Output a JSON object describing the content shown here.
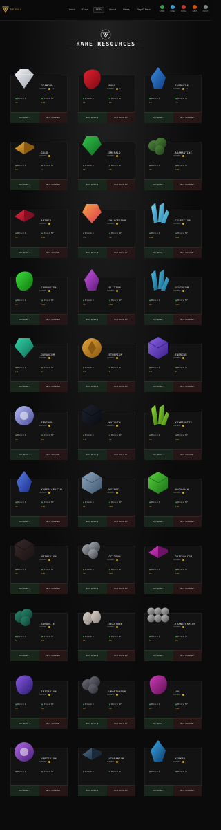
{
  "brand": {
    "name": "NEBULA"
  },
  "nav": [
    "Land",
    "Skins",
    "NFTs",
    "About",
    "News",
    "Play & Earn"
  ],
  "nav_active": 2,
  "tokens": [
    {
      "label": "STAR",
      "color": "#2ea043"
    },
    {
      "label": "LUNA",
      "color": "#3da0d8"
    },
    {
      "label": "NOVA",
      "color": "#c0392b"
    },
    {
      "label": "GEM",
      "color": "#d35400"
    },
    {
      "label": "DUST",
      "color": "#7f8c8d"
    }
  ],
  "page_title": "RARE RESOURCES",
  "labels": {
    "owned": "OWNED:",
    "price_usd": "Price in $",
    "price_nf": "Price in NF",
    "buy": "BUY WITH $",
    "sell": "BUY WITH NF"
  },
  "resources": [
    {
      "name": "DIAMOND",
      "owned": "12",
      "usd": "30",
      "nf": "125",
      "icon": "diamond"
    },
    {
      "name": "RUBY",
      "owned": "6",
      "usd": "15",
      "nf": "60",
      "icon": "ruby"
    },
    {
      "name": "SAPPHIRE",
      "owned": "11",
      "usd": "18",
      "nf": "75",
      "icon": "sapphire"
    },
    {
      "name": "GOLD",
      "owned": "",
      "usd": "10",
      "nf": "3",
      "icon": "gold"
    },
    {
      "name": "EMERALD",
      "owned": "",
      "usd": "12",
      "nf": "48",
      "icon": "emerald"
    },
    {
      "name": "ADAMANTINE",
      "owned": "",
      "usd": "40",
      "nf": "160",
      "icon": "adamantine"
    },
    {
      "name": "AETHER",
      "owned": "",
      "usd": "35",
      "nf": "140",
      "icon": "aether"
    },
    {
      "name": "CHALCEDIUM",
      "owned": "",
      "usd": "7.5",
      "nf": "30",
      "icon": "chalcedium"
    },
    {
      "name": "CELESTIUM",
      "owned": "",
      "usd": "100",
      "nf": "400",
      "icon": "celestium"
    },
    {
      "name": "CHRONOTON",
      "owned": "",
      "usd": "25",
      "nf": "100",
      "icon": "chronoton"
    },
    {
      "name": "ELITIUM",
      "owned": "",
      "usd": "50",
      "nf": "200",
      "icon": "elitium"
    },
    {
      "name": "DIVINIUM",
      "owned": "",
      "usd": "80",
      "nf": "320",
      "icon": "divinium"
    },
    {
      "name": "DURANIUM",
      "owned": "",
      "usd": "1.5",
      "nf": "6",
      "icon": "duranium"
    },
    {
      "name": "ETHERIUM",
      "owned": "",
      "usd": "1.5",
      "nf": "6",
      "icon": "etherium"
    },
    {
      "name": "ENERGON",
      "owned": "",
      "usd": "1.5",
      "nf": "6",
      "icon": "energon"
    },
    {
      "name": "FEMINOR",
      "owned": "",
      "usd": "20",
      "nf": "80",
      "icon": "feminor"
    },
    {
      "name": "KATCHIN",
      "owned": "",
      "usd": "5.5",
      "nf": "22",
      "icon": "katchin"
    },
    {
      "name": "KRYPTONITE",
      "owned": "",
      "usd": "50",
      "nf": "200",
      "icon": "kryptonite"
    },
    {
      "name": "KYBER CRYSTAL",
      "owned": "",
      "usd": "45",
      "nf": "180",
      "icon": "kyber"
    },
    {
      "name": "MYTHRIL",
      "owned": "",
      "usd": "65",
      "nf": "260",
      "icon": "mythril"
    },
    {
      "name": "NAQAHDAH",
      "owned": "",
      "usd": "45",
      "nf": "180",
      "icon": "naqahdah"
    },
    {
      "name": "NETHERIUM",
      "owned": "",
      "usd": "40",
      "nf": "160",
      "icon": "netherium"
    },
    {
      "name": "OCTIRON",
      "owned": "",
      "usd": "30",
      "nf": "120",
      "icon": "octiron"
    },
    {
      "name": "ORICHALCUM",
      "owned": "",
      "usd": "25",
      "nf": "100",
      "icon": "orichalcum"
    },
    {
      "name": "SARONITE",
      "owned": "",
      "usd": "5",
      "nf": "20",
      "icon": "saronite"
    },
    {
      "name": "SEASTONE",
      "owned": "",
      "usd": "15",
      "nf": "60",
      "icon": "seastone"
    },
    {
      "name": "TRANSFERMIUM",
      "owned": "",
      "usd": "5",
      "nf": "20",
      "icon": "transfermium"
    },
    {
      "name": "TRITANIUM",
      "owned": "",
      "usd": "20",
      "nf": "80",
      "icon": "tritanium"
    },
    {
      "name": "UNOBTANIUM",
      "owned": "",
      "usd": "20",
      "nf": "80",
      "icon": "unobtanium"
    },
    {
      "name": "URU",
      "owned": "",
      "usd": "25",
      "nf": "100",
      "icon": "uru"
    },
    {
      "name": "VERTERIUM",
      "owned": "",
      "usd": "",
      "nf": "",
      "icon": "verterium"
    },
    {
      "name": "VIBRANIUM",
      "owned": "",
      "usd": "",
      "nf": "",
      "icon": "vibranium"
    },
    {
      "name": "XIRKBB",
      "owned": "",
      "usd": "",
      "nf": "",
      "icon": "xirkbb"
    }
  ]
}
